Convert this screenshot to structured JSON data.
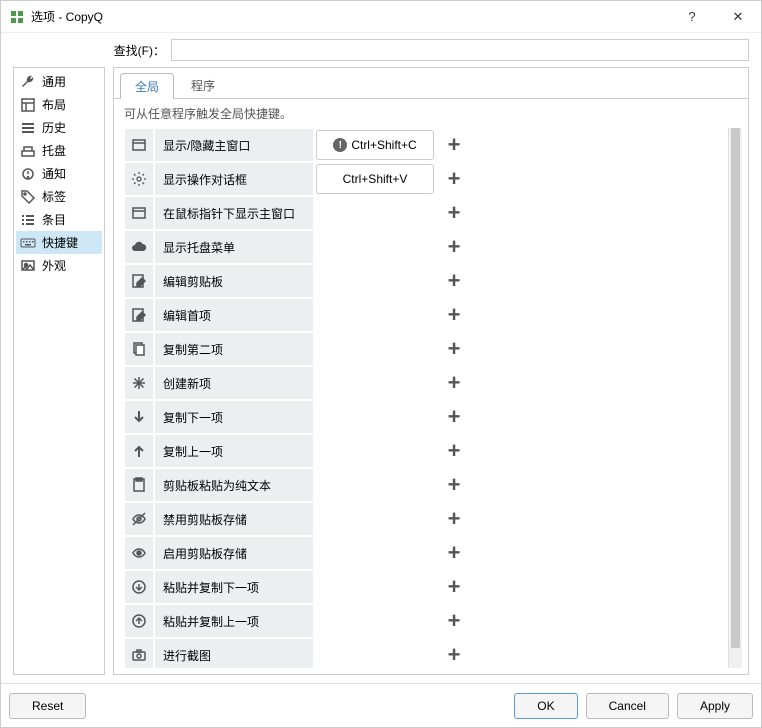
{
  "window": {
    "title": "选项 - CopyQ"
  },
  "titlebar": {
    "help": "?",
    "close": "✕"
  },
  "search": {
    "label": "查找(F)：",
    "value": ""
  },
  "sidebar": {
    "items": [
      {
        "label": "通用",
        "icon": "wrench-icon"
      },
      {
        "label": "布局",
        "icon": "layout-icon"
      },
      {
        "label": "历史",
        "icon": "list-icon"
      },
      {
        "label": "托盘",
        "icon": "tray-icon"
      },
      {
        "label": "通知",
        "icon": "notify-icon"
      },
      {
        "label": "标签",
        "icon": "tags-icon"
      },
      {
        "label": "条目",
        "icon": "item-icon"
      },
      {
        "label": "快捷键",
        "icon": "keyboard-icon",
        "active": true
      },
      {
        "label": "外观",
        "icon": "appearance-icon"
      }
    ]
  },
  "tabs": {
    "items": [
      {
        "label": "全局",
        "active": true
      },
      {
        "label": "程序",
        "active": false
      }
    ],
    "hint": "可从任意程序触发全局快捷键。"
  },
  "shortcuts": [
    {
      "icon": "window-icon",
      "label": "显示/隐藏主窗口",
      "key": "Ctrl+Shift+C",
      "warn": true
    },
    {
      "icon": "gear-icon",
      "label": "显示操作对话框",
      "key": "Ctrl+Shift+V"
    },
    {
      "icon": "window-icon",
      "label": "在鼠标指针下显示主窗口"
    },
    {
      "icon": "cloud-icon",
      "label": "显示托盘菜单"
    },
    {
      "icon": "edit-icon",
      "label": "编辑剪贴板"
    },
    {
      "icon": "edit-icon",
      "label": "编辑首项"
    },
    {
      "icon": "copy-icon",
      "label": "复制第二项"
    },
    {
      "icon": "asterisk-icon",
      "label": "创建新项"
    },
    {
      "icon": "arrow-down-icon",
      "label": "复制下一项"
    },
    {
      "icon": "arrow-up-icon",
      "label": "复制上一项"
    },
    {
      "icon": "paste-icon",
      "label": "剪贴板粘贴为纯文本"
    },
    {
      "icon": "eye-off-icon",
      "label": "禁用剪贴板存储"
    },
    {
      "icon": "eye-icon",
      "label": "启用剪贴板存储"
    },
    {
      "icon": "down-circle-icon",
      "label": "粘贴并复制下一项"
    },
    {
      "icon": "up-circle-icon",
      "label": "粘贴并复制上一项"
    },
    {
      "icon": "camera-icon",
      "label": "进行截图"
    }
  ],
  "footer": {
    "reset": "Reset",
    "ok": "OK",
    "cancel": "Cancel",
    "apply": "Apply"
  }
}
